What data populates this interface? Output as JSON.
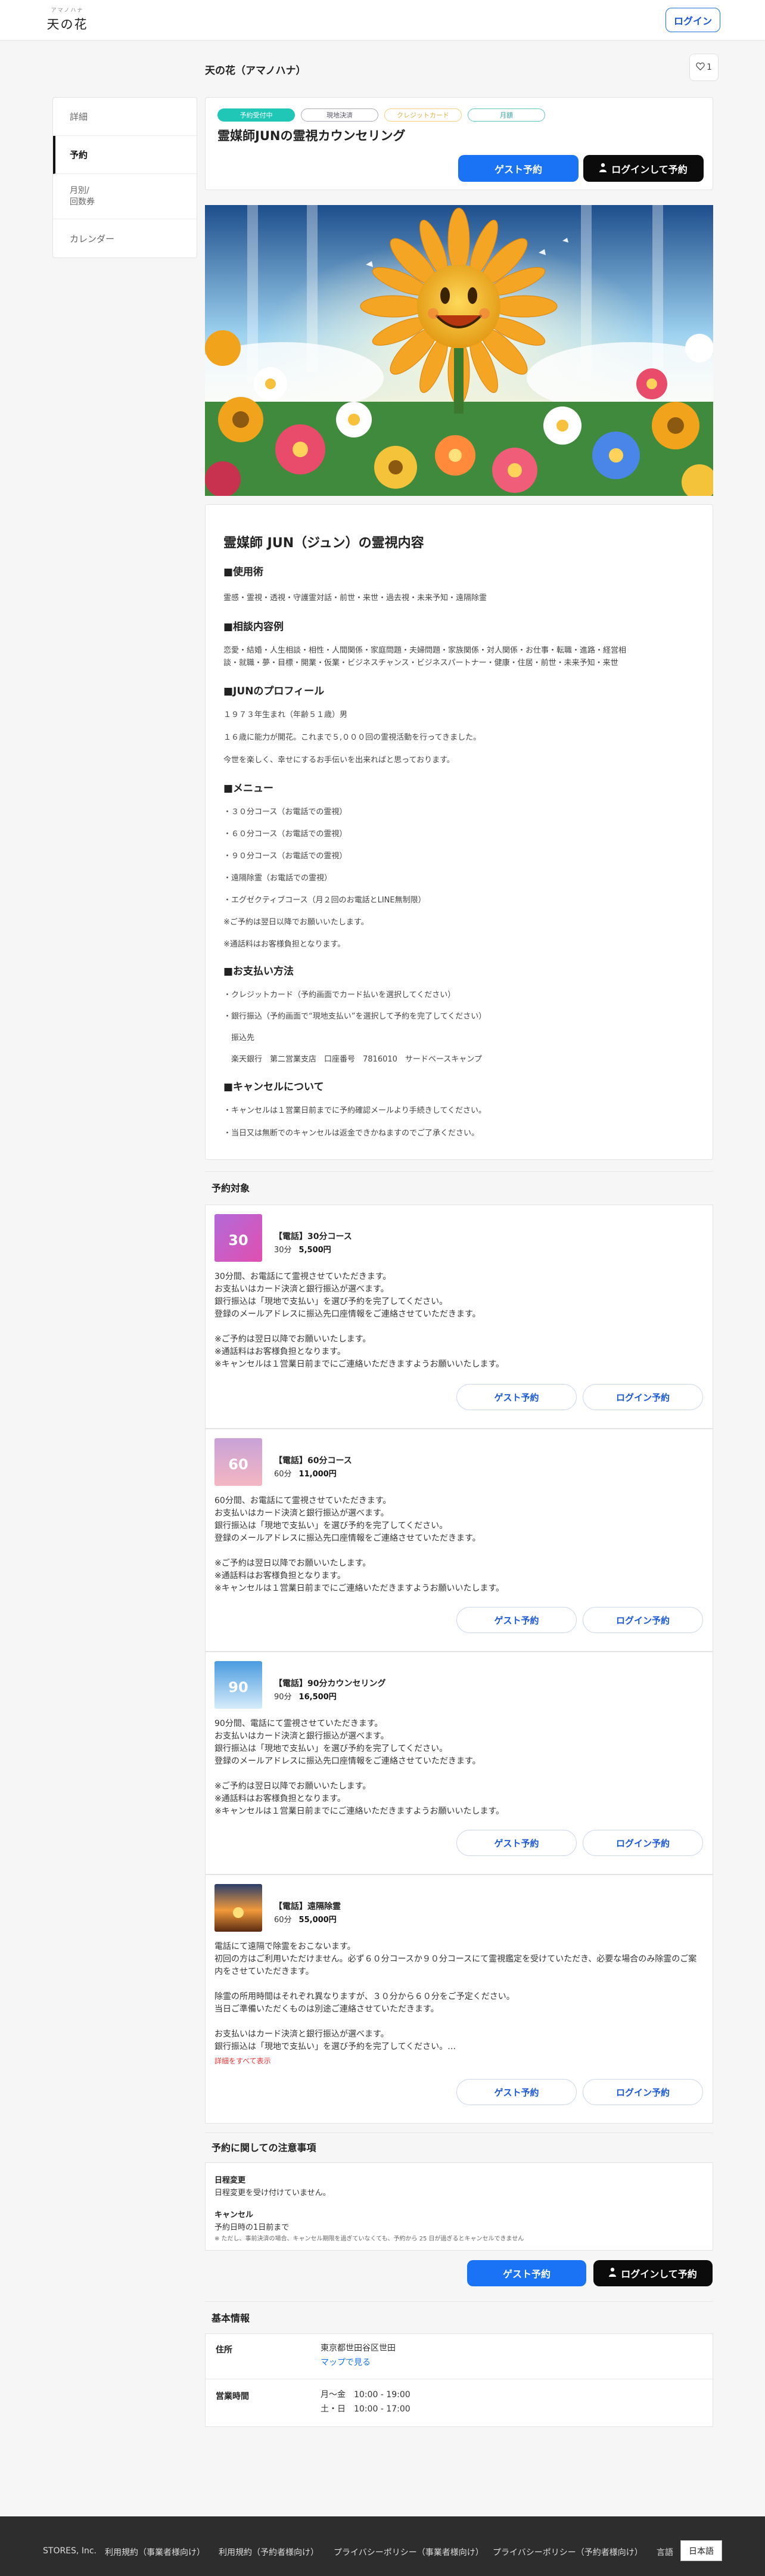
{
  "header": {
    "logo_small": "アマノハナ",
    "logo_main": "天の花",
    "login_label": "ログイン"
  },
  "store": {
    "name": "天の花（アマノハナ）",
    "favorite_count": "1"
  },
  "sidebar": {
    "items": [
      {
        "label": "詳細"
      },
      {
        "label": "予約"
      },
      {
        "label": "月別/\n回数券"
      },
      {
        "label": "カレンダー"
      }
    ]
  },
  "event": {
    "tags": [
      "予約受付中",
      "現地決済",
      "クレジットカード",
      "月額"
    ],
    "title": "霊媒師JUNの霊視カウンセリング",
    "guest_label": "ゲスト予約",
    "login_label": "ログインして予約"
  },
  "description": {
    "heading": "霊媒師 JUN（ジュン）の霊視内容",
    "sections": [
      {
        "title": "■使用術",
        "lines": [
          "霊感・霊視・透視・守護霊対話・前世・来世・過去視・未来予知・遠隔除霊"
        ]
      },
      {
        "title": "■相談内容例",
        "lines": [
          "恋愛・結婚・人生相談・相性・人間関係・家庭問題・夫婦問題・家族関係・対人関係・お仕事・転職・進路・経営相",
          "談・就職・夢・目標・開業・仮業・ビジネスチャンス・ビジネスパートナー・健康・住居・前世・未来予知・来世"
        ]
      },
      {
        "title": "■JUNのプロフィール",
        "lines": [
          "１９７３年生まれ（年齢５１歳）男",
          "１６歳に能力が開花。これまで５,０００回の霊視活動を行ってきました。",
          "今世を楽しく、幸せにするお手伝いを出来ればと思っております。"
        ]
      },
      {
        "title": "■メニュー",
        "lines": [
          "・３０分コース（お電話での霊視）",
          "・６０分コース（お電話での霊視）",
          "・９０分コース（お電話での霊視）",
          "・遠隔除霊（お電話での霊視）",
          "・エグゼクティブコース（月２回のお電話とLINE無制限）",
          "※ご予約は翌日以降でお願いいたします。",
          "※通話料はお客様負担となります。"
        ]
      },
      {
        "title": "■お支払い方法",
        "lines": [
          "・クレジットカード（予約画面でカード払いを選択してください）",
          "・銀行振込（予約画面で“現地支払い”を選択して予約を完了してください）",
          "　振込先",
          "　楽天銀行　第二営業支店　口座番号　7816010　サードベースキャンプ"
        ]
      },
      {
        "title": "■キャンセルについて",
        "lines": [
          "・キャンセルは１営業日前までに予約確認メールより手続きしてください。",
          "・当日又は無断でのキャンセルは返金できかねますのでご了承ください。"
        ]
      }
    ]
  },
  "menus_heading": "予約対象",
  "menus": [
    {
      "title": "【電話】30分コース",
      "duration": "30分",
      "price": "5,500円",
      "thumb_text": "30",
      "body": [
        "30分間、お電話にて霊視させていただきます。",
        "お支払いはカード決済と銀行振込が選べます。",
        "銀行振込は「現地で支払い」を選び予約を完了してください。",
        "登録のメールアドレスに振込先口座情報をご連絡させていただきます。",
        "",
        "※ご予約は翌日以降でお願いいたします。",
        "※通話料はお客様負担となります。",
        "※キャンセルは１営業日前までにご連絡いただきますようお願いいたします。"
      ],
      "read_more": "",
      "guest_label": "ゲスト予約",
      "login_label": "ログイン予約"
    },
    {
      "title": "【電話】60分コース",
      "duration": "60分",
      "price": "11,000円",
      "thumb_text": "60",
      "body": [
        "60分間、お電話にて霊視させていただきます。",
        "お支払いはカード決済と銀行振込が選べます。",
        "銀行振込は「現地で支払い」を選び予約を完了してください。",
        "登録のメールアドレスに振込先口座情報をご連絡させていただきます。",
        "",
        "※ご予約は翌日以降でお願いいたします。",
        "※通話料はお客様負担となります。",
        "※キャンセルは１営業日前までにご連絡いただきますようお願いいたします。"
      ],
      "read_more": "",
      "guest_label": "ゲスト予約",
      "login_label": "ログイン予約"
    },
    {
      "title": "【電話】90分カウンセリング",
      "duration": "90分",
      "price": "16,500円",
      "thumb_text": "90",
      "body": [
        "90分間、電話にて霊視させていただきます。",
        "お支払いはカード決済と銀行振込が選べます。",
        "銀行振込は「現地で支払い」を選び予約を完了してください。",
        "登録のメールアドレスに振込先口座情報をご連絡させていただきます。",
        "",
        "※ご予約は翌日以降でお願いいたします。",
        "※通話料はお客様負担となります。",
        "※キャンセルは１営業日前までにご連絡いただきますようお願いいたします。"
      ],
      "read_more": "",
      "guest_label": "ゲスト予約",
      "login_label": "ログイン予約"
    },
    {
      "title": "【電話】遠隔除霊",
      "duration": "60分",
      "price": "55,000円",
      "thumb_text": "",
      "body": [
        "電話にて遠隔で除霊をおこないます。",
        "初回の方はご利用いただけません。必ず６０分コースか９０分コースにて霊視鑑定を受けていただき、必要な場合のみ除霊のご案",
        "内をさせていただきます。",
        "",
        "除霊の所用時間はそれぞれ異なりますが、３０分から６０分をご予定ください。",
        "当日ご準備いただくものは別途ご連絡させていただきます。",
        "",
        "お支払いはカード決済と銀行振込が選べます。",
        "銀行振込は「現地で支払い」を選び予約を完了してください。…"
      ],
      "read_more": "詳細をすべて表示",
      "guest_label": "ゲスト予約",
      "login_label": "ログイン予約"
    }
  ],
  "notes": {
    "heading": "予約に関しての注意事項",
    "change_title": "日程変更",
    "change_text": "日程変更を受け付けていません。",
    "cancel_title": "キャンセル",
    "cancel_text": "予約日時の1日前まで",
    "cancel_small": "※ ただし、事前決済の場合、キャンセル期限を過ぎていなくても、予約から 25 日が過ぎるとキャンセルできません",
    "guest_label": "ゲスト予約",
    "login_label": "ログインして予約"
  },
  "info": {
    "heading": "基本情報",
    "address_label": "住所",
    "address": "東京都世田谷区世田",
    "map_link": "マップで見る",
    "hours_label": "営業時間",
    "hours": [
      "月〜金　10:00 - 19:00",
      "土・日　10:00 - 17:00"
    ]
  },
  "footer": {
    "links": [
      "STORES, Inc.",
      "利用規約（事業者様向け）",
      "利用規約（予約者様向け）",
      "プライバシーポリシー（事業者様向け）",
      "プライバシーポリシー（予約者様向け）"
    ],
    "lang_label": "言語",
    "lang_value": "日本語"
  },
  "colors": {
    "accent": "#1a73f5",
    "dark_button": "#0b0b0b",
    "tag_active": "#20c6b6",
    "read_more": "#e33333"
  }
}
